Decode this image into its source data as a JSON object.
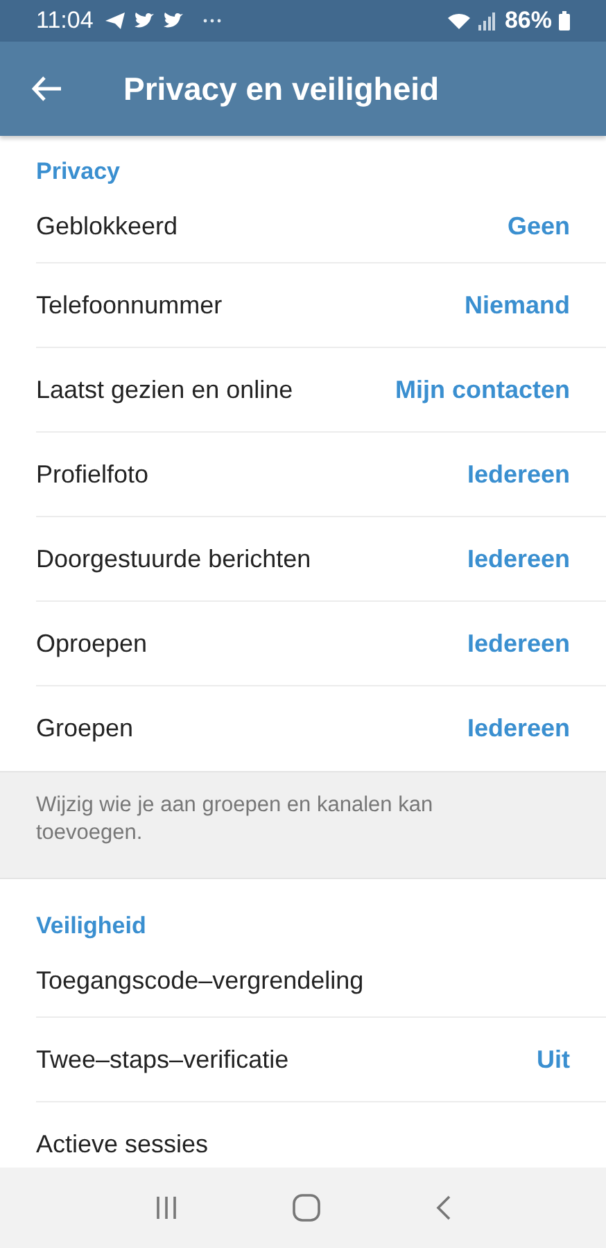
{
  "status_bar": {
    "time": "11:04",
    "battery": "86%"
  },
  "toolbar": {
    "title": "Privacy en veiligheid"
  },
  "sections": [
    {
      "header": "Privacy",
      "rows": [
        {
          "label": "Geblokkeerd",
          "value": "Geen"
        },
        {
          "label": "Telefoonnummer",
          "value": "Niemand"
        },
        {
          "label": "Laatst gezien en online",
          "value": "Mijn contacten"
        },
        {
          "label": "Profielfoto",
          "value": "Iedereen"
        },
        {
          "label": "Doorgestuurde berichten",
          "value": "Iedereen"
        },
        {
          "label": "Oproepen",
          "value": "Iedereen"
        },
        {
          "label": "Groepen",
          "value": "Iedereen"
        }
      ],
      "footer": "Wijzig wie je aan groepen en kanalen kan toevoegen."
    },
    {
      "header": "Veiligheid",
      "rows": [
        {
          "label": "Toegangscode–vergrendeling"
        },
        {
          "label": "Twee–staps–verificatie",
          "value": "Uit"
        },
        {
          "label": "Actieve sessies"
        }
      ]
    }
  ]
}
